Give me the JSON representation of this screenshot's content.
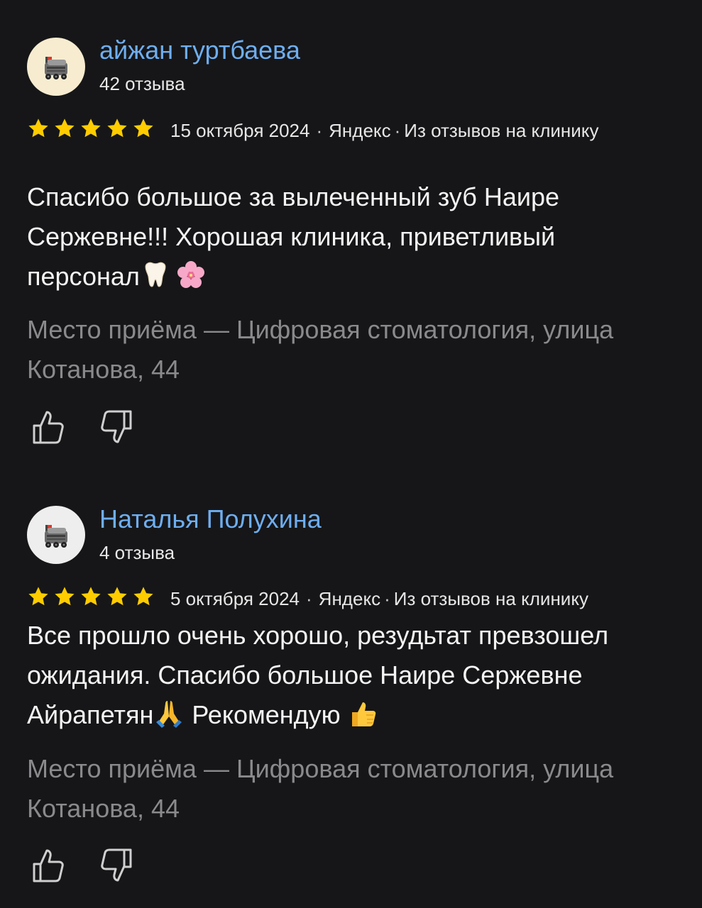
{
  "colors": {
    "background": "#161618",
    "author_link": "#6eaef0",
    "star": "#ffcc00",
    "muted": "#8a8a8d"
  },
  "reviews": [
    {
      "author": "айжан туртбаева",
      "review_count": "42 отзыва",
      "rating": 5,
      "date": "15 октября 2024",
      "source": "Яндекс",
      "origin": "Из отзывов на клинику",
      "text": "Спасибо большое за вылеченный зуб Наире Сержевне!!! Хорошая клиника, приветливый персонал",
      "text_emojis": [
        "tooth-emoji",
        "cherry-blossom-emoji"
      ],
      "place": "Место приёма — Цифровая стоматология, улица Котанова, 44",
      "avatar_icon": "delivery-robot-icon"
    },
    {
      "author": "Наталья Полухина",
      "review_count": "4 отзыва",
      "rating": 5,
      "date": "5 октября 2024",
      "source": "Яндекс",
      "origin": "Из отзывов на клинику",
      "text_part1": "Все прошло очень хорошо, резудьтат превзошел ожидания. Спасибо большое Наире Сержевне Айрапетян",
      "text_part2": " Рекомендую ",
      "text_emojis": [
        "folded-hands-emoji",
        "thumbs-up-emoji"
      ],
      "place": "Место приёма — Цифровая стоматология, улица Котанова, 44",
      "avatar_icon": "delivery-robot-icon"
    }
  ],
  "actions": {
    "like_icon": "thumbs-up-outline-icon",
    "dislike_icon": "thumbs-down-outline-icon"
  }
}
